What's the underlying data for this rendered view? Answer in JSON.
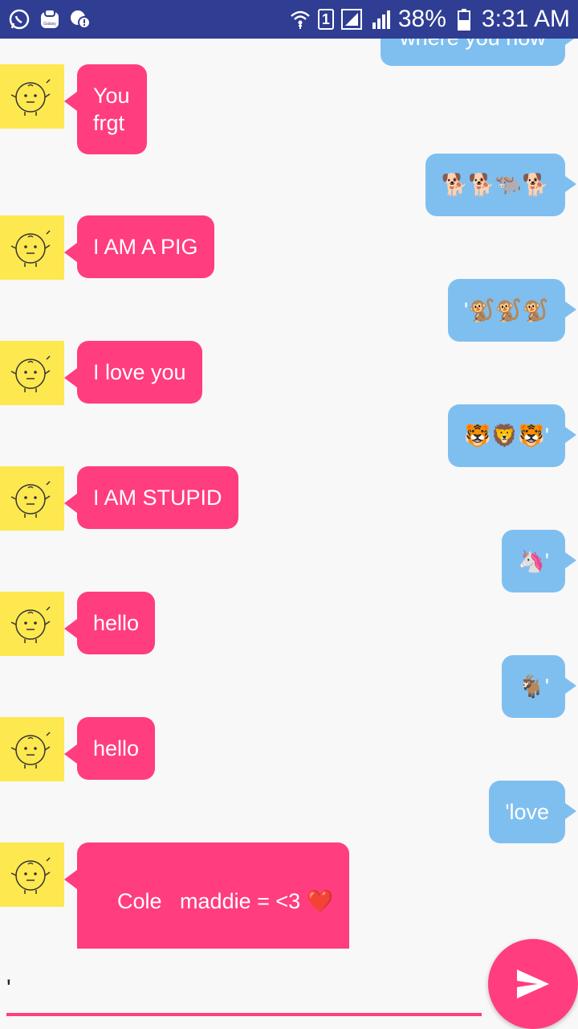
{
  "status_bar": {
    "battery_percent": "38%",
    "time": "3:31 AM",
    "sim_number": "1",
    "galaxy_label": "Galaxy"
  },
  "colors": {
    "bot_bubble": "#ff3d7f",
    "user_bubble": "#7fbff0",
    "avatar_bg": "#fde84f",
    "status_bar": "#2f3d93"
  },
  "messages": [
    {
      "sender": "user",
      "text": "where you now"
    },
    {
      "sender": "bot",
      "text": "You frgt"
    },
    {
      "sender": "user",
      "text": "🐕🐕🐃🐕"
    },
    {
      "sender": "bot",
      "text": "I AM A PIG"
    },
    {
      "sender": "user",
      "text": "'🐒🐒🐒"
    },
    {
      "sender": "bot",
      "text": "I love you"
    },
    {
      "sender": "user",
      "text": "🐯🦁🐯'"
    },
    {
      "sender": "bot",
      "text": "I AM STUPID"
    },
    {
      "sender": "user",
      "text": "🦄'"
    },
    {
      "sender": "bot",
      "text": "hello"
    },
    {
      "sender": "user",
      "text": "🐐'"
    },
    {
      "sender": "bot",
      "text": "hello"
    },
    {
      "sender": "user",
      "text": "'love"
    },
    {
      "sender": "bot",
      "text": "Cole   maddie = <3 ❤️"
    }
  ],
  "input": {
    "value": "'",
    "placeholder": ""
  },
  "icons": {
    "send": "send-icon",
    "whatsapp": "whatsapp-icon",
    "wifi": "wifi-icon"
  }
}
